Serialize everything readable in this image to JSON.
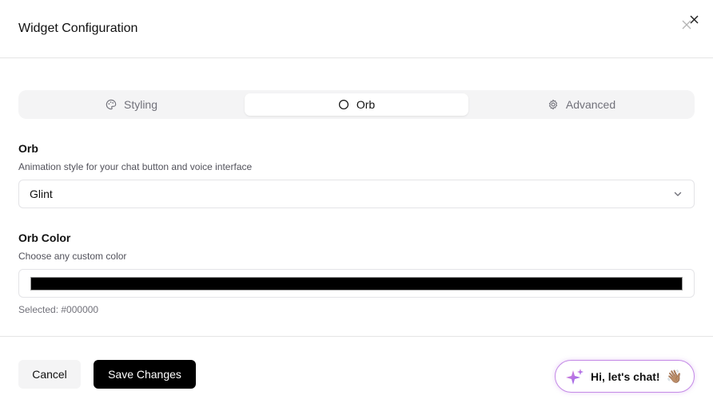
{
  "dialog": {
    "title": "Widget Configuration"
  },
  "tabs": [
    {
      "label": "Styling",
      "icon": "palette-icon",
      "active": false
    },
    {
      "label": "Orb",
      "icon": "circle-icon",
      "active": true
    },
    {
      "label": "Advanced",
      "icon": "gear-icon",
      "active": false
    }
  ],
  "orb": {
    "label": "Orb",
    "hint": "Animation style for your chat button and voice interface",
    "selected": "Glint"
  },
  "orb_color": {
    "label": "Orb Color",
    "hint": "Choose any custom color",
    "value": "#000000",
    "selected_text": "Selected: #000000"
  },
  "footer": {
    "cancel_label": "Cancel",
    "save_label": "Save Changes"
  },
  "chat_widget": {
    "text": "Hi, let's chat!",
    "emoji": "👋🏽",
    "icon": "sparkle-icon"
  },
  "colors": {
    "accent": "#000000",
    "tab_bg": "#f4f4f5",
    "widget_border": "#c48ae6"
  }
}
